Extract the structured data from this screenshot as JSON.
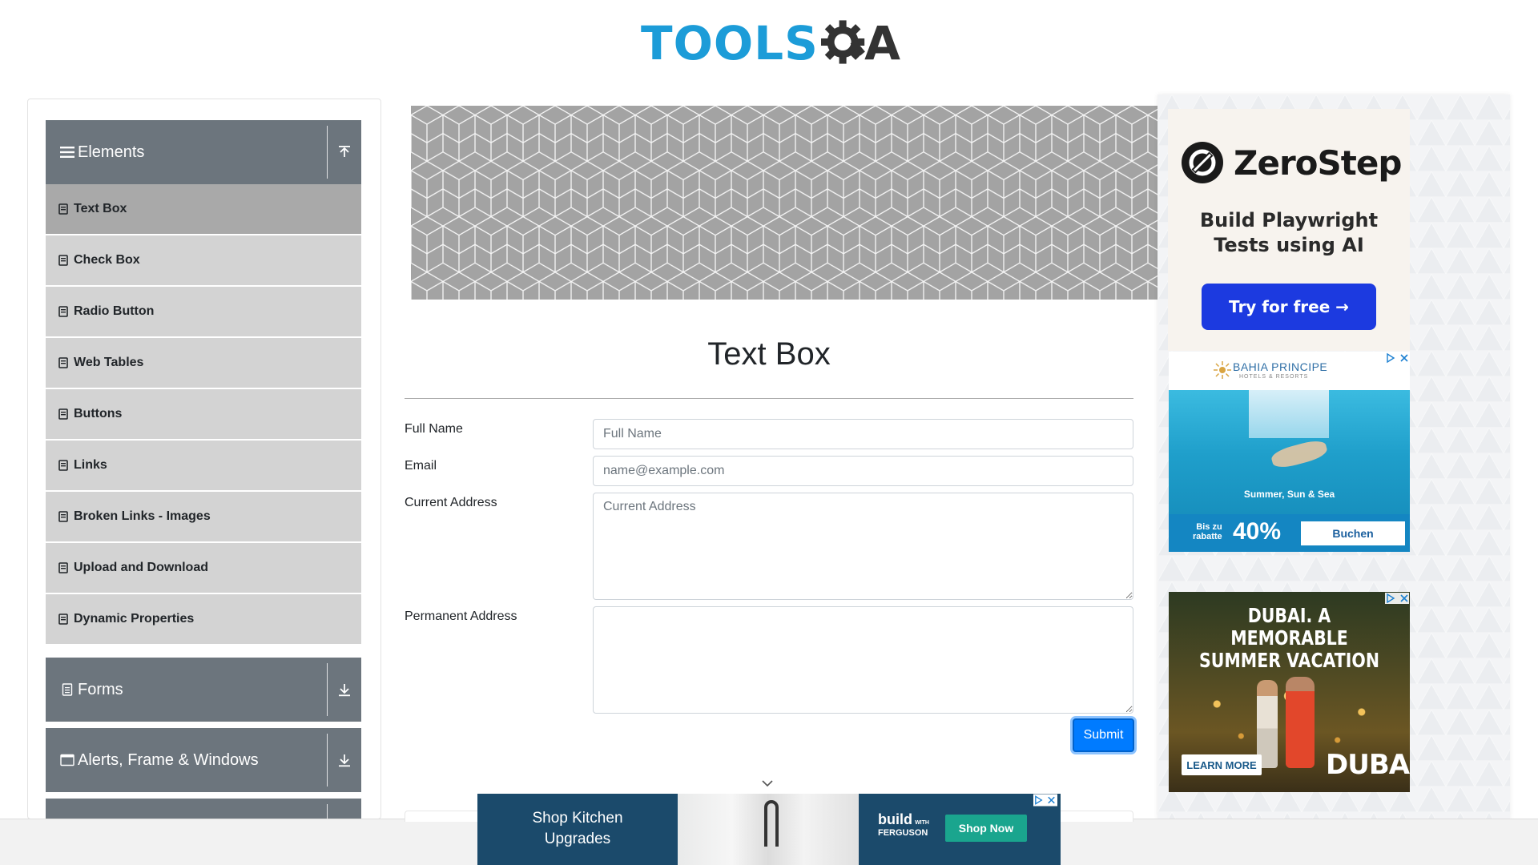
{
  "logo": {
    "part1": "TOOLS",
    "part2": "A"
  },
  "sidebar": {
    "elements_group": {
      "title": "Elements",
      "icon": "hamburger-icon",
      "arrow": "upload-arrow-icon"
    },
    "items": [
      {
        "label": "Text Box",
        "active": true
      },
      {
        "label": "Check Box",
        "active": false
      },
      {
        "label": "Radio Button",
        "active": false
      },
      {
        "label": "Web Tables",
        "active": false
      },
      {
        "label": "Buttons",
        "active": false
      },
      {
        "label": "Links",
        "active": false
      },
      {
        "label": "Broken Links - Images",
        "active": false
      },
      {
        "label": "Upload and Download",
        "active": false
      },
      {
        "label": "Dynamic Properties",
        "active": false
      }
    ],
    "forms_group": {
      "title": "Forms",
      "icon": "document-icon",
      "arrow": "download-arrow-icon"
    },
    "alerts_group": {
      "title": "Alerts, Frame & Windows",
      "icon": "window-icon",
      "arrow": "download-arrow-icon"
    }
  },
  "main": {
    "title": "Text Box",
    "form": {
      "full_name_label": "Full Name",
      "full_name_placeholder": "Full Name",
      "email_label": "Email",
      "email_placeholder": "name@example.com",
      "current_address_label": "Current Address",
      "current_address_placeholder": "Current Address",
      "permanent_address_label": "Permanent Address",
      "submit_label": "Submit"
    }
  },
  "ads": {
    "zerostep": {
      "brand": "ZeroStep",
      "tagline_line1": "Build Playwright",
      "tagline_line2": "Tests using AI",
      "button": "Try for free →"
    },
    "bahia": {
      "brand": "BAHIA PRINCIPE",
      "sub": "HOTELS & RESORTS",
      "slogan": "Summer, Sun & Sea",
      "bis_line1": "Bis zu",
      "bis_line2": "rabatte",
      "percent": "40%",
      "button": "Buchen"
    },
    "dubai": {
      "headline_line1": "DUBAI. A MEMORABLE",
      "headline_line2": "SUMMER VACATION",
      "learn_more": "LEARN MORE",
      "brand": "DUBAI"
    },
    "kitchen": {
      "text_line1": "Shop Kitchen",
      "text_line2": "Upgrades",
      "brand_top": "build",
      "brand_mid": "WITH",
      "brand_bottom": "FERGUSON",
      "button": "Shop Now"
    }
  },
  "colors": {
    "brand_blue": "#1c9cd8",
    "sidebar_group": "#6c757d",
    "sidebar_item": "#d3d3d3",
    "sidebar_item_active": "#a9a9a9",
    "submit_blue": "#007bff"
  }
}
